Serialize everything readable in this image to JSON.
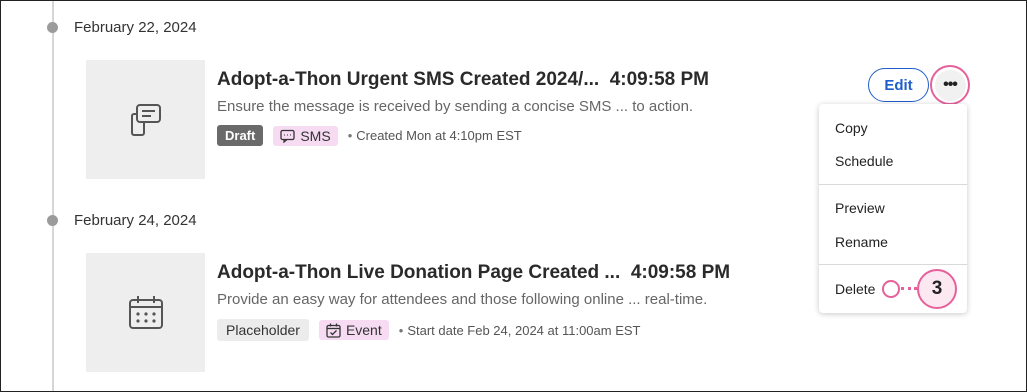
{
  "timeline": [
    {
      "date": "February 22, 2024",
      "icon": "sms-document-icon",
      "title": "Adopt-a-Thon Urgent SMS Created 2024/...",
      "time": "4:09:58 PM",
      "description": "Ensure the message is received by sending a concise SMS ...  to action.",
      "status_badge": "Draft",
      "type_icon": "chat-bubble-icon",
      "type_label": "SMS",
      "meta_text": "Created Mon at 4:10pm EST"
    },
    {
      "date": "February 24, 2024",
      "icon": "calendar-icon",
      "title": "Adopt-a-Thon Live Donation Page Created ...",
      "time": "4:09:58 PM",
      "description": "Provide an easy way for attendees and those following online ... real-time.",
      "status_badge": "Placeholder",
      "type_icon": "event-calendar-icon",
      "type_label": "Event",
      "meta_text": "Start date Feb 24, 2024 at 11:00am EST"
    }
  ],
  "actions": {
    "edit_label": "Edit",
    "more_label": "•••"
  },
  "menu": {
    "items": [
      "Copy",
      "Schedule",
      "Preview",
      "Rename",
      "Delete"
    ]
  },
  "callout": {
    "number": "3"
  },
  "meta_separator": "•",
  "colors": {
    "accent_pink": "#e6619b",
    "edit_blue": "#1f5fcc",
    "type_badge_bg": "#f6dbf3",
    "draft_badge_bg": "#6a6a6a"
  }
}
